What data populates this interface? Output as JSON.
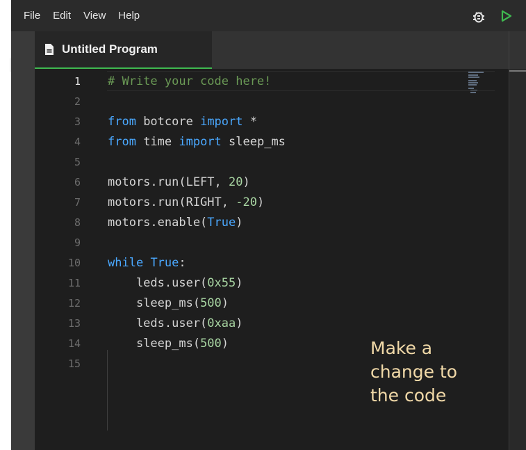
{
  "menu": {
    "items": [
      "File",
      "Edit",
      "View",
      "Help"
    ]
  },
  "toolbar": {
    "debug_icon": "bug-icon",
    "run_icon": "play-icon",
    "run_color": "#3fb950"
  },
  "tab": {
    "label": "Untitled Program",
    "icon": "file-icon",
    "accent": "#3fb950"
  },
  "editor": {
    "active_line": 1,
    "lines": [
      {
        "n": "1",
        "tokens": [
          {
            "t": "# Write your code here!",
            "c": "cm"
          }
        ]
      },
      {
        "n": "2",
        "tokens": []
      },
      {
        "n": "3",
        "tokens": [
          {
            "t": "from",
            "c": "kw"
          },
          {
            "t": " botcore ",
            "c": ""
          },
          {
            "t": "import",
            "c": "kw"
          },
          {
            "t": " *",
            "c": ""
          }
        ]
      },
      {
        "n": "4",
        "tokens": [
          {
            "t": "from",
            "c": "kw"
          },
          {
            "t": " time ",
            "c": ""
          },
          {
            "t": "import",
            "c": "kw"
          },
          {
            "t": " sleep_ms",
            "c": ""
          }
        ]
      },
      {
        "n": "5",
        "tokens": []
      },
      {
        "n": "6",
        "tokens": [
          {
            "t": "motors.run(LEFT, ",
            "c": ""
          },
          {
            "t": "20",
            "c": "num"
          },
          {
            "t": ")",
            "c": ""
          }
        ]
      },
      {
        "n": "7",
        "tokens": [
          {
            "t": "motors.run(RIGHT, ",
            "c": ""
          },
          {
            "t": "-20",
            "c": "num"
          },
          {
            "t": ")",
            "c": ""
          }
        ]
      },
      {
        "n": "8",
        "tokens": [
          {
            "t": "motors.enable(",
            "c": ""
          },
          {
            "t": "True",
            "c": "kw"
          },
          {
            "t": ")",
            "c": ""
          }
        ]
      },
      {
        "n": "9",
        "tokens": []
      },
      {
        "n": "10",
        "tokens": [
          {
            "t": "while",
            "c": "kw"
          },
          {
            "t": " ",
            "c": ""
          },
          {
            "t": "True",
            "c": "kw"
          },
          {
            "t": ":",
            "c": ""
          }
        ]
      },
      {
        "n": "11",
        "tokens": [
          {
            "t": "    leds.user(",
            "c": ""
          },
          {
            "t": "0x55",
            "c": "num"
          },
          {
            "t": ")",
            "c": ""
          }
        ]
      },
      {
        "n": "12",
        "tokens": [
          {
            "t": "    sleep_ms(",
            "c": ""
          },
          {
            "t": "500",
            "c": "num"
          },
          {
            "t": ")",
            "c": ""
          }
        ]
      },
      {
        "n": "13",
        "tokens": [
          {
            "t": "    leds.user(",
            "c": ""
          },
          {
            "t": "0xaa",
            "c": "num"
          },
          {
            "t": ")",
            "c": ""
          }
        ]
      },
      {
        "n": "14",
        "tokens": [
          {
            "t": "    sleep_ms(",
            "c": ""
          },
          {
            "t": "500",
            "c": "num"
          },
          {
            "t": ")",
            "c": ""
          }
        ]
      },
      {
        "n": "15",
        "tokens": []
      }
    ]
  },
  "annotation": {
    "lines": [
      "Make a",
      "change to",
      "the code"
    ]
  }
}
